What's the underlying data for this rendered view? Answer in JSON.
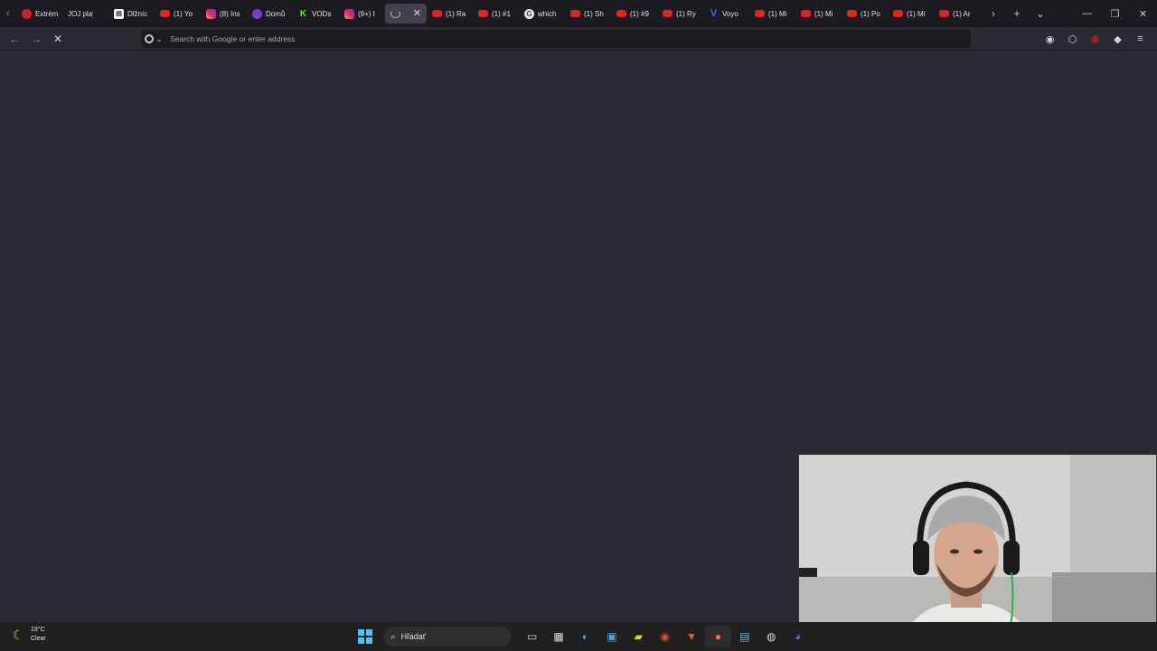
{
  "browser": {
    "tabs": [
      {
        "label": "Extrém",
        "favicon": "red-dot-icon"
      },
      {
        "label": "JOJ play",
        "favicon": "none"
      },
      {
        "label": "Dlžníc",
        "favicon": "document-icon"
      },
      {
        "label": "(1) Yo",
        "favicon": "youtube-icon"
      },
      {
        "label": "(8) Ins",
        "favicon": "instagram-icon"
      },
      {
        "label": "Domů",
        "favicon": "purple-dot-icon"
      },
      {
        "label": "VODs",
        "favicon": "kick-icon"
      },
      {
        "label": "(9+) I",
        "favicon": "instagram-icon"
      },
      {
        "label": "",
        "favicon": "loading-icon",
        "active": true
      },
      {
        "label": "(1) Ra",
        "favicon": "youtube-icon"
      },
      {
        "label": "(1) #1",
        "favicon": "youtube-icon"
      },
      {
        "label": "which",
        "favicon": "google-icon"
      },
      {
        "label": "(1) Sh",
        "favicon": "youtube-icon"
      },
      {
        "label": "(1) #9",
        "favicon": "youtube-icon"
      },
      {
        "label": "(1) Ry",
        "favicon": "youtube-icon"
      },
      {
        "label": "Voyo",
        "favicon": "voyo-icon"
      },
      {
        "label": "(1) Mi",
        "favicon": "youtube-icon"
      },
      {
        "label": "(1) Mi",
        "favicon": "youtube-icon"
      },
      {
        "label": "(1) Po",
        "favicon": "youtube-icon"
      },
      {
        "label": "(1) Mi",
        "favicon": "youtube-icon"
      },
      {
        "label": "(1) Ar",
        "favicon": "youtube-icon"
      }
    ],
    "address_placeholder": "Search with Google or enter address",
    "address_value": ""
  },
  "taskbar": {
    "weather_temp": "19°C",
    "weather_desc": "Clear",
    "search_label": "Hľadať",
    "apps": [
      "task-view-icon",
      "store-icon",
      "edge-icon",
      "photos-icon",
      "file-explorer-icon",
      "chrome-icon",
      "brave-icon",
      "firefox-icon",
      "notepad-icon",
      "steam-icon",
      "discord-icon"
    ]
  },
  "colors": {
    "content_bg": "#2b2a33",
    "tabstrip_bg": "#1c1b22",
    "taskbar_bg": "#202020",
    "youtube_red": "#e02424"
  }
}
